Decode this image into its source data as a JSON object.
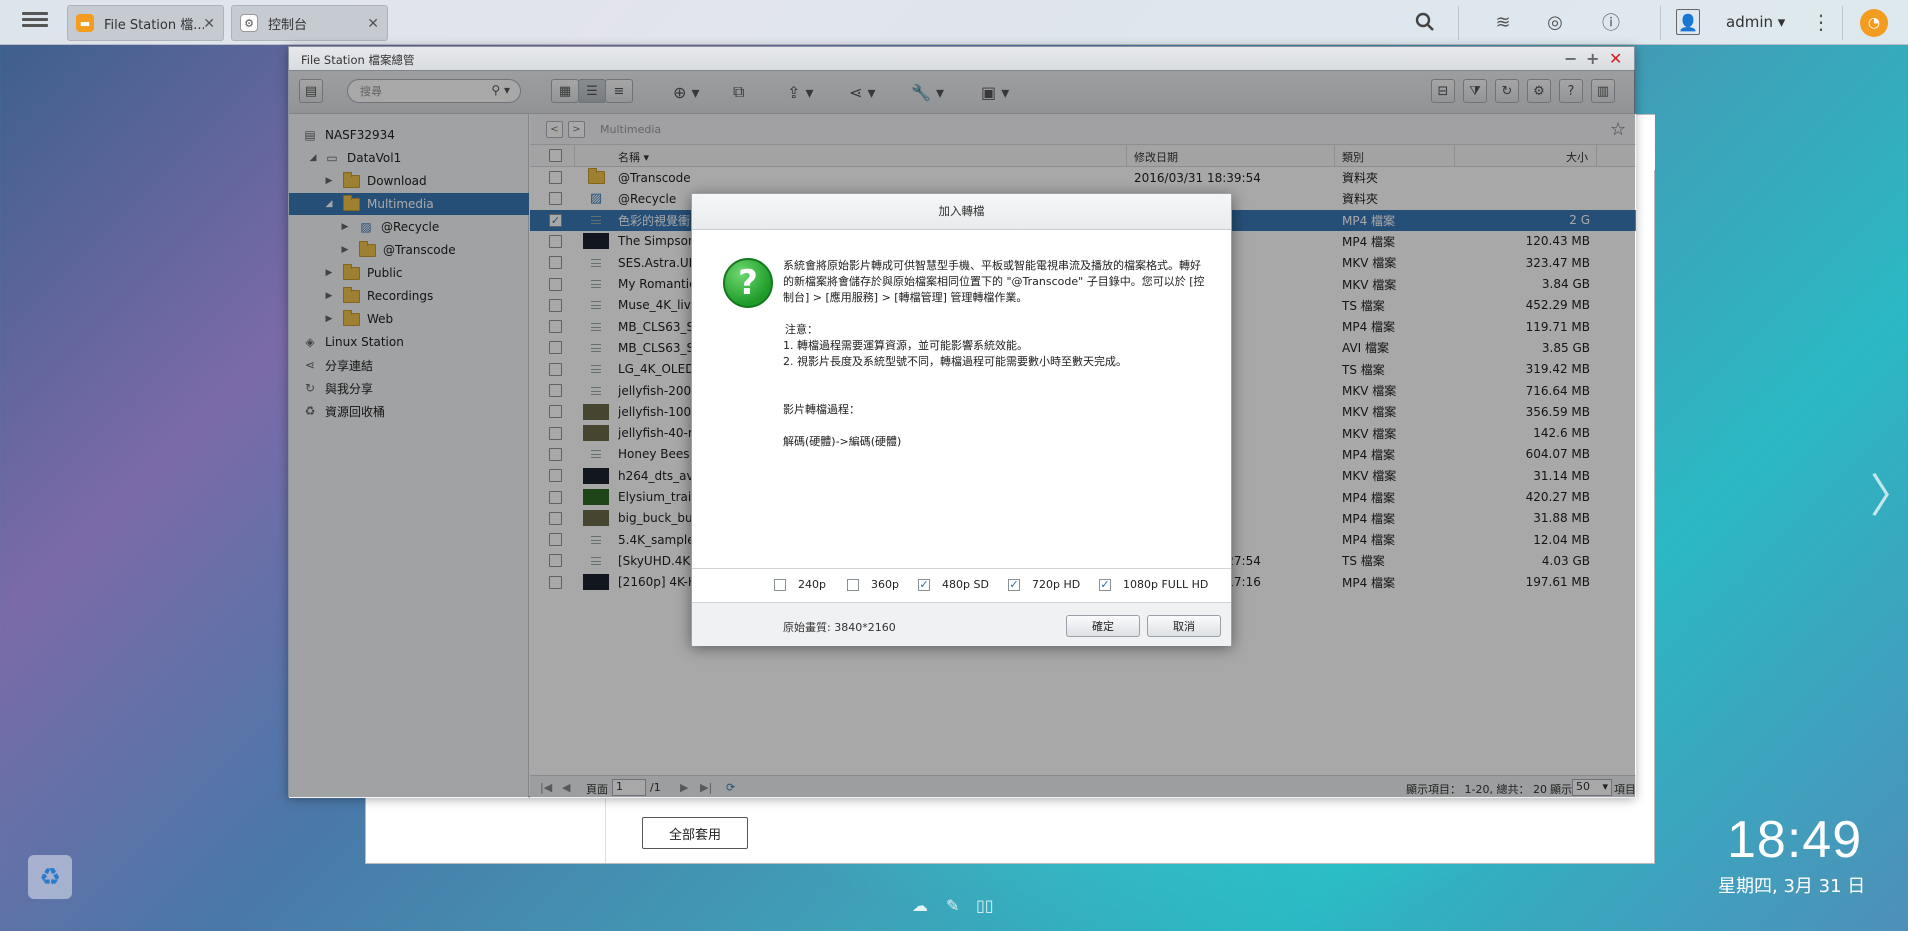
{
  "topbar": {
    "tabs": [
      {
        "label": "File Station 檔...",
        "icon": "file-station-icon"
      },
      {
        "label": "控制台",
        "icon": "control-panel-icon"
      }
    ],
    "user": "admin"
  },
  "window": {
    "title": "File Station 檔案總管"
  },
  "toolbar": {
    "search_placeholder": "搜尋"
  },
  "sidebar": {
    "items": [
      {
        "label": "NASF32934"
      },
      {
        "label": "DataVol1"
      },
      {
        "label": "Download"
      },
      {
        "label": "Multimedia"
      },
      {
        "label": "@Recycle"
      },
      {
        "label": "@Transcode"
      },
      {
        "label": "Public"
      },
      {
        "label": "Recordings"
      },
      {
        "label": "Web"
      },
      {
        "label": "Linux Station"
      },
      {
        "label": "分享連結"
      },
      {
        "label": "與我分享"
      },
      {
        "label": "資源回收桶"
      }
    ]
  },
  "path": {
    "current": "Multimedia"
  },
  "table": {
    "headers": {
      "name": "名稱",
      "date": "修改日期",
      "type": "類別",
      "size": "大小"
    },
    "rows": [
      {
        "name": "@Transcode",
        "date": "2016/03/31 18:39:54",
        "type": "資料夾",
        "size": ""
      },
      {
        "name": "@Recycle",
        "date": "54",
        "type": "資料夾",
        "size": ""
      },
      {
        "name": "色彩的視覺衝",
        "date": "34",
        "type": "MP4 檔案",
        "size": "2 G"
      },
      {
        "name": "The Simpsons",
        "date": "09",
        "type": "MP4 檔案",
        "size": "120.43 MB"
      },
      {
        "name": "SES.Astra.UH",
        "date": "15",
        "type": "MKV 檔案",
        "size": "323.47 MB"
      },
      {
        "name": "My Romantic",
        "date": "04",
        "type": "MKV 檔案",
        "size": "3.84 GB"
      },
      {
        "name": "Muse_4K_live",
        "date": "11",
        "type": "TS 檔案",
        "size": "452.29 MB"
      },
      {
        "name": "MB_CLS63_S",
        "date": "03",
        "type": "MP4 檔案",
        "size": "119.71 MB"
      },
      {
        "name": "MB_CLS63_S",
        "date": "08",
        "type": "AVI 檔案",
        "size": "3.85 GB"
      },
      {
        "name": "LG_4K_OLED_",
        "date": "22",
        "type": "TS 檔案",
        "size": "319.42 MB"
      },
      {
        "name": "jellyfish-200-n",
        "date": "19",
        "type": "MKV 檔案",
        "size": "716.64 MB"
      },
      {
        "name": "jellyfish-100-n",
        "date": "03",
        "type": "MKV 檔案",
        "size": "356.59 MB"
      },
      {
        "name": "jellyfish-40-m",
        "date": "54",
        "type": "MKV 檔案",
        "size": "142.6 MB"
      },
      {
        "name": "Honey Bees 9",
        "date": "48",
        "type": "MP4 檔案",
        "size": "604.07 MB"
      },
      {
        "name": "h264_dts_ava",
        "date": "01",
        "type": "MKV 檔案",
        "size": "31.14 MB"
      },
      {
        "name": "Elysium_traile",
        "date": "01",
        "type": "MP4 檔案",
        "size": "420.27 MB"
      },
      {
        "name": "big_buck_bun",
        "date": "54",
        "type": "MP4 檔案",
        "size": "31.88 MB"
      },
      {
        "name": "5.4K_sample_",
        "date": "46",
        "type": "MP4 檔案",
        "size": "12.04 MB"
      },
      {
        "name": "[SkyUHD.4K.現場] 韓國KARA - DAY&NIGHT 2160p UHDTV HEVC_60fps_10bit.ts",
        "date": "2016/02/27 08:27:54",
        "type": "TS 檔案",
        "size": "4.03 GB"
      },
      {
        "name": "[2160p] 4K-HD.Club-2013-Taipei 101 Fireworks Trailer (4ksamples.com).mp4",
        "date": "2016/03/01 14:17:16",
        "type": "MP4 檔案",
        "size": "197.61 MB"
      }
    ]
  },
  "status": {
    "page_label": "頁面",
    "page": "1",
    "total_pages": "/1",
    "summary": "顯示項目： 1-20, 總共： 20",
    "show_label": "顯示",
    "per_page": "50",
    "items_label": "項目"
  },
  "dialog": {
    "title": "加入轉檔",
    "desc": "系統會將原始影片轉成可供智慧型手機、平板或智能電視串流及播放的檔案格式。轉好的新檔案將會儲存於與原始檔案相同位置下的 \"@Transcode\" 子目錄中。您可以於 [控制台] > [應用服務] > [轉檔管理] 管理轉檔作業。",
    "note_title": "注意：",
    "note1": "1. 轉檔過程需要運算資源，並可能影響系統效能。",
    "note2": "2. 視影片長度及系統型號不同，轉檔過程可能需要數小時至數天完成。",
    "process_title": "影片轉檔過程：",
    "process": "解碼(硬體)->編碼(硬體)",
    "options": [
      {
        "label": "240p",
        "checked": false
      },
      {
        "label": "360p",
        "checked": false
      },
      {
        "label": "480p SD",
        "checked": true
      },
      {
        "label": "720p HD",
        "checked": true
      },
      {
        "label": "1080p FULL HD",
        "checked": true
      }
    ],
    "resolution": "原始畫質: 3840*2160",
    "ok": "確定",
    "cancel": "取消"
  },
  "control_panel": {
    "apply_all": "全部套用"
  },
  "desktop": {
    "time": "18:49",
    "date": "星期四, 3月 31 日"
  }
}
